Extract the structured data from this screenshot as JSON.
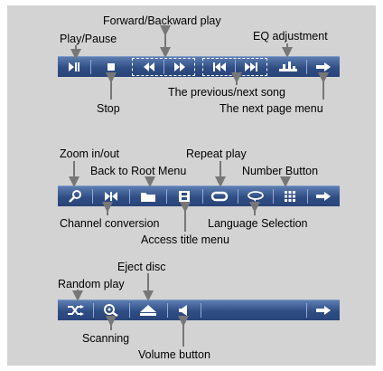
{
  "labels": {
    "forward_backward": "Forward/Backward play",
    "play_pause": "Play/Pause",
    "eq": "EQ adjustment",
    "prev_next": "The previous/next song",
    "stop": "Stop",
    "next_page": "The next page menu",
    "zoom": "Zoom in/out",
    "repeat": "Repeat play",
    "back_root": "Back to Root Menu",
    "number": "Number Button",
    "channel": "Channel conversion",
    "language": "Language Selection",
    "access_title": "Access title menu",
    "eject": "Eject disc",
    "random": "Random play",
    "scanning": "Scanning",
    "volume": "Volume button"
  },
  "icons": {
    "bar1": [
      "play-pause-icon",
      "stop-icon",
      "rewind-icon",
      "fast-forward-icon",
      "previous-track-icon",
      "next-track-icon",
      "eq-icon",
      "next-page-arrow-icon"
    ],
    "bar2": [
      "zoom-icon",
      "channel-icon",
      "folder-icon",
      "title-menu-icon",
      "repeat-icon",
      "language-icon",
      "number-grid-icon",
      "next-page-arrow-icon"
    ],
    "bar3": [
      "shuffle-icon",
      "scan-icon",
      "eject-icon",
      "volume-icon",
      "next-page-arrow-icon"
    ]
  },
  "colors": {
    "bar": "#2f4d84",
    "panel": "#d3d3d3",
    "icon": "#ffffff"
  }
}
